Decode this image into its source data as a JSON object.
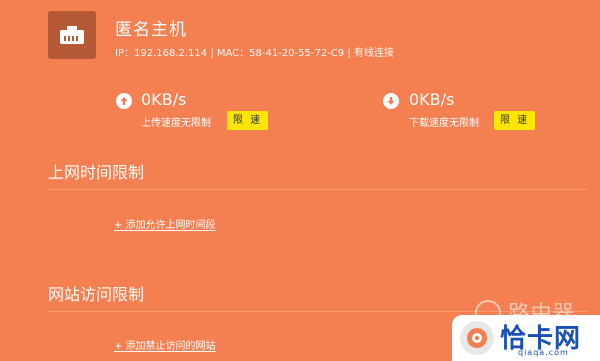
{
  "device": {
    "name": "匿名主机",
    "info": "IP：192.168.2.114 | MAC：58-41-20-55-72-C9 | 有线连接",
    "icon": "ethernet-port-icon"
  },
  "upload": {
    "value": "0KB/s",
    "label": "上传速度无限制",
    "button": "限 速",
    "icon": "arrow-up-circle-icon"
  },
  "download": {
    "value": "0KB/s",
    "label": "下载速度无限制",
    "button": "限 速",
    "icon": "arrow-down-circle-icon"
  },
  "time_limit": {
    "title": "上网时间限制",
    "add_link": "+ 添加允许上网时间段"
  },
  "site_limit": {
    "title": "网站访问限制",
    "add_link": "+ 添加禁止访问的网站"
  },
  "watermark": {
    "text": "路由器",
    "logo_text": "恰卡网",
    "logo_url": "qiaqa.com"
  },
  "colors": {
    "background": "#f47f50",
    "limit_button": "#ffe600",
    "icon_tile": "#b45a37",
    "logo_text": "#1a4fb4"
  }
}
